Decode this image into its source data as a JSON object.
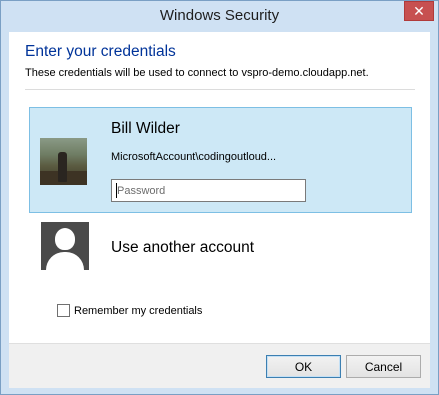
{
  "window": {
    "title": "Windows Security",
    "close_glyph": "✕"
  },
  "header": {
    "heading": "Enter your credentials",
    "subheading": "These credentials will be used to connect to vspro-demo.cloudapp.net."
  },
  "selected_account": {
    "name": "Bill Wilder",
    "account": "MicrosoftAccount\\codingoutloud...",
    "password_placeholder": "Password",
    "password_value": ""
  },
  "other_account": {
    "label": "Use another account"
  },
  "remember": {
    "label": "Remember my credentials",
    "checked": false
  },
  "buttons": {
    "ok": "OK",
    "cancel": "Cancel"
  },
  "colors": {
    "heading": "#003399",
    "selected_tile_bg": "#cde8f6",
    "selected_tile_border": "#7dbfe4",
    "close_button": "#c75050"
  }
}
